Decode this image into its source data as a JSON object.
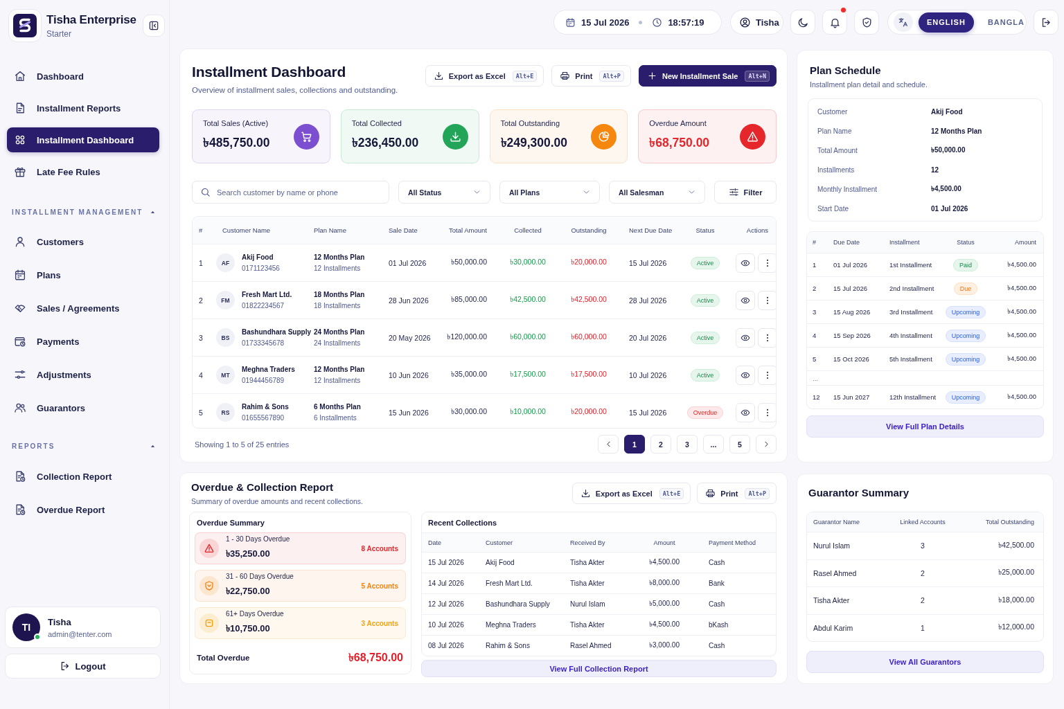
{
  "sidebar": {
    "brand": {
      "name": "Tisha Enterprise",
      "plan": "Starter"
    },
    "nav": [
      {
        "label": "Dashboard",
        "selected": false
      },
      {
        "label": "Installment Reports",
        "selected": false
      },
      {
        "label": "Installment Dashboard",
        "selected": true
      },
      {
        "label": "Late Fee Rules",
        "selected": false
      }
    ],
    "sections": [
      {
        "title": "INSTALLMENT MANAGEMENT",
        "expanded": true,
        "items": [
          {
            "label": "Customers",
            "selected": false
          },
          {
            "label": "Plans",
            "selected": false
          },
          {
            "label": "Sales / Agreements",
            "selected": false
          },
          {
            "label": "Payments",
            "selected": false
          },
          {
            "label": "Adjustments",
            "selected": false
          },
          {
            "label": "Guarantors",
            "selected": false
          }
        ]
      },
      {
        "title": "REPORTS",
        "expanded": true,
        "items": [
          {
            "label": "Collection Report",
            "selected": false
          },
          {
            "label": "Overdue Report",
            "selected": false
          }
        ]
      }
    ],
    "user": {
      "initials": "TI",
      "name": "Tisha",
      "email": "admin@tenter.com",
      "online": true
    },
    "logout": "Logout"
  },
  "topbar": {
    "date": "15 Jul 2026",
    "time": "18:57:19",
    "user": "Tisha",
    "unread": true,
    "languages": [
      {
        "label": "ENGLISH",
        "selected": true
      },
      {
        "label": "BANGLA",
        "selected": false
      }
    ]
  },
  "dashboard": {
    "title": "Installment Dashboard",
    "subtitle": "Overview of installment sales, collections and outstanding.",
    "actions": [
      {
        "kind": "export",
        "label": "Export as Excel",
        "shortcut": "Alt+E"
      },
      {
        "kind": "print",
        "label": "Print",
        "shortcut": "Alt+P"
      },
      {
        "kind": "primary",
        "label": "New Installment Sale",
        "shortcut": "Alt+N"
      }
    ],
    "stats": [
      {
        "label": "Total Sales (Active)",
        "value": "৳485,750.00",
        "color": "#7b4fd0",
        "kind": "normal"
      },
      {
        "label": "Total Collected",
        "value": "৳236,450.00",
        "color": "#22a559",
        "kind": "normal"
      },
      {
        "label": "Total Outstanding",
        "value": "৳249,300.00",
        "color": "#f5870f",
        "kind": "normal"
      },
      {
        "label": "Overdue Amount",
        "value": "৳68,750.00",
        "color": "#e5262b",
        "kind": "alert"
      }
    ],
    "filters": {
      "search": {
        "placeholder": "Search customer by name or phone"
      },
      "dropdowns": [
        "All Status",
        "All Plans",
        "All Salesman"
      ],
      "button": "Filter"
    },
    "table": {
      "columns": [
        "#",
        "Customer Name",
        "Plan Name",
        "Sale Date",
        "Total Amount",
        "Collected",
        "Outstanding",
        "Next Due Date",
        "Status",
        "Actions"
      ],
      "rows": [
        {
          "index": "1",
          "initials": "AF",
          "customer": "Akij Food",
          "phone": "0171123456",
          "plan": "12 Months Plan",
          "installments": "12 Installments",
          "sale_date": "01 Jul 2026",
          "total": "৳50,000.00",
          "collected": "৳30,000.00",
          "outstanding": "৳20,000.00",
          "next_due": "15 Jul 2026",
          "status": {
            "label": "Active",
            "kind": "active"
          }
        },
        {
          "index": "2",
          "initials": "FM",
          "customer": "Fresh Mart Ltd.",
          "phone": "01822234567",
          "plan": "18 Months Plan",
          "installments": "18 Installments",
          "sale_date": "28 Jun 2026",
          "total": "৳85,000.00",
          "collected": "৳42,500.00",
          "outstanding": "৳42,500.00",
          "next_due": "28 Jul 2026",
          "status": {
            "label": "Active",
            "kind": "active"
          }
        },
        {
          "index": "3",
          "initials": "BS",
          "customer": "Bashundhara Supply",
          "phone": "01733345678",
          "plan": "24 Months Plan",
          "installments": "24 Installments",
          "sale_date": "20 May 2026",
          "total": "৳120,000.00",
          "collected": "৳60,000.00",
          "outstanding": "৳60,000.00",
          "next_due": "20 Jul 2026",
          "status": {
            "label": "Active",
            "kind": "active"
          }
        },
        {
          "index": "4",
          "initials": "MT",
          "customer": "Meghna Traders",
          "phone": "01944456789",
          "plan": "12 Months Plan",
          "installments": "12 Installments",
          "sale_date": "10 Jun 2026",
          "total": "৳35,000.00",
          "collected": "৳17,500.00",
          "outstanding": "৳17,500.00",
          "next_due": "10 Jul 2026",
          "status": {
            "label": "Active",
            "kind": "active"
          }
        },
        {
          "index": "5",
          "initials": "RS",
          "customer": "Rahim & Sons",
          "phone": "01655567890",
          "plan": "6 Months Plan",
          "installments": "6 Installments",
          "sale_date": "15 Jun 2026",
          "total": "৳30,000.00",
          "collected": "৳10,000.00",
          "outstanding": "৳20,000.00",
          "next_due": "15 Jul 2026",
          "status": {
            "label": "Overdue",
            "kind": "overdue"
          }
        }
      ]
    },
    "pagination": {
      "info": "Showing 1 to 5 of 25 entries",
      "pages": [
        {
          "label": "1",
          "selected": true
        },
        {
          "label": "2",
          "selected": false
        },
        {
          "label": "3",
          "selected": false
        },
        {
          "label": "...",
          "selected": false
        },
        {
          "label": "5",
          "selected": false
        }
      ]
    }
  },
  "report": {
    "title": "Overdue & Collection Report",
    "subtitle": "Summary of overdue amounts and recent collections.",
    "actions": [
      {
        "kind": "export",
        "label": "Export as Excel",
        "shortcut": "Alt+E"
      },
      {
        "kind": "print",
        "label": "Print",
        "shortcut": "Alt+P"
      }
    ],
    "overdue": {
      "title": "Overdue Summary",
      "buckets": [
        {
          "label": "1 - 30 Days Overdue",
          "amount": "৳35,250.00",
          "accounts": "8 Accounts",
          "color": "#e5262b"
        },
        {
          "label": "31 - 60 Days Overdue",
          "amount": "৳22,750.00",
          "accounts": "5 Accounts",
          "color": "#f5820d"
        },
        {
          "label": "61+ Days Overdue",
          "amount": "৳10,750.00",
          "accounts": "3 Accounts",
          "color": "#f2a20f"
        }
      ],
      "total_label": "Total Overdue",
      "total_value": "৳68,750.00"
    },
    "collections": {
      "title": "Recent Collections",
      "columns": [
        "Date",
        "Customer",
        "Received By",
        "Amount",
        "Payment Method"
      ],
      "rows": [
        [
          "15 Jul 2026",
          "Akij Food",
          "Tisha Akter",
          "৳4,500.00",
          "Cash"
        ],
        [
          "14 Jul 2026",
          "Fresh Mart Ltd.",
          "Tisha Akter",
          "৳8,000.00",
          "Bank"
        ],
        [
          "12 Jul 2026",
          "Bashundhara Supply",
          "Nurul Islam",
          "৳5,000.00",
          "Cash"
        ],
        [
          "10 Jul 2026",
          "Meghna Traders",
          "Tisha Akter",
          "৳4,500.00",
          "bKash"
        ],
        [
          "08 Jul 2026",
          "Rahim & Sons",
          "Rasel Ahmed",
          "৳3,000.00",
          "Cash"
        ]
      ],
      "button": "View Full Collection Report"
    }
  },
  "plan_schedule": {
    "title": "Plan Schedule",
    "subtitle": "Installment plan detail and schedule.",
    "details": [
      {
        "label": "Customer",
        "value": "Akij Food"
      },
      {
        "label": "Plan Name",
        "value": "12 Months Plan"
      },
      {
        "label": "Total Amount",
        "value": "৳50,000.00"
      },
      {
        "label": "Installments",
        "value": "12"
      },
      {
        "label": "Monthly Installment",
        "value": "৳4,500.00"
      },
      {
        "label": "Start Date",
        "value": "01 Jul 2026"
      }
    ],
    "columns": [
      "#",
      "Due Date",
      "Installment",
      "Status",
      "Amount"
    ],
    "rows": [
      {
        "kind": "installment",
        "index": "1",
        "due_date": "01 Jul 2026",
        "installment": "1st Installment",
        "status": {
          "label": "Paid",
          "kind": "paid"
        },
        "amount": "৳4,500.00"
      },
      {
        "kind": "installment",
        "index": "2",
        "due_date": "15 Jul 2026",
        "installment": "2nd Installment",
        "status": {
          "label": "Due",
          "kind": "due"
        },
        "amount": "৳4,500.00"
      },
      {
        "kind": "installment",
        "index": "3",
        "due_date": "15 Aug 2026",
        "installment": "3rd Installment",
        "status": {
          "label": "Upcoming",
          "kind": "upcoming"
        },
        "amount": "৳4,500.00"
      },
      {
        "kind": "installment",
        "index": "4",
        "due_date": "15 Sep 2026",
        "installment": "4th Installment",
        "status": {
          "label": "Upcoming",
          "kind": "upcoming"
        },
        "amount": "৳4,500.00"
      },
      {
        "kind": "installment",
        "index": "5",
        "due_date": "15 Oct 2026",
        "installment": "5th Installment",
        "status": {
          "label": "Upcoming",
          "kind": "upcoming"
        },
        "amount": "৳4,500.00"
      },
      {
        "kind": "gap",
        "index": "..."
      },
      {
        "kind": "installment",
        "index": "12",
        "due_date": "15 Jun 2027",
        "installment": "12th Installment",
        "status": {
          "label": "Upcoming",
          "kind": "upcoming"
        },
        "amount": "৳4,500.00"
      }
    ],
    "button": "View Full Plan Details"
  },
  "guarantors": {
    "title": "Guarantor Summary",
    "columns": [
      "Guarantor Name",
      "Linked Accounts",
      "Total Outstanding"
    ],
    "rows": [
      [
        "Nurul Islam",
        "3",
        "৳42,500.00"
      ],
      [
        "Rasel Ahmed",
        "2",
        "৳25,000.00"
      ],
      [
        "Tisha Akter",
        "2",
        "৳18,000.00"
      ],
      [
        "Abdul Karim",
        "1",
        "৳12,000.00"
      ]
    ],
    "button": "View All Guarantors"
  }
}
